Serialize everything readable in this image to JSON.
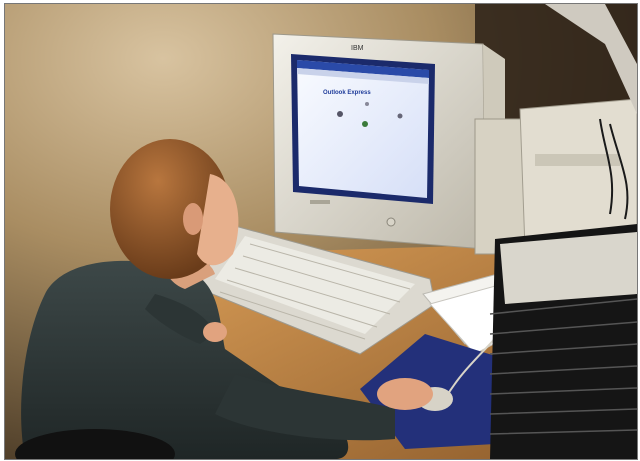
{
  "scene": {
    "monitor_brand": "IBM",
    "screen_app_title": "Outlook Express"
  },
  "colors": {
    "wall": "#b59d72",
    "wall_shadow": "#5e4c33",
    "desk": "#c78a4a",
    "monitor": "#e9e6dc",
    "screen": "#eef2ff",
    "screen_bezel": "#1b2a6b",
    "keyboard": "#dedbd2",
    "sweater": "#2f3a3a",
    "hair": "#9a5a2a",
    "skin": "#e7b08d",
    "mousepad": "#23307a",
    "cd_case": "#1c1c1c"
  }
}
